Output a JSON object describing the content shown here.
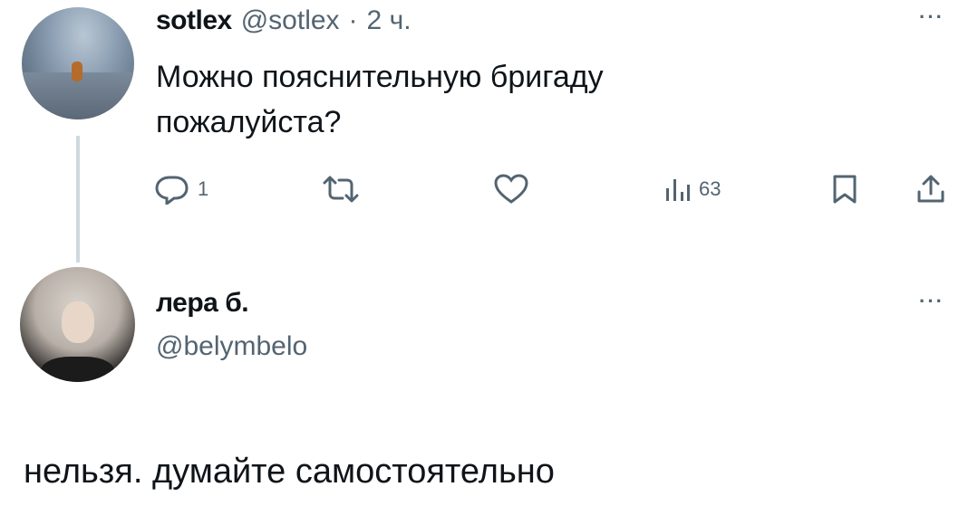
{
  "tweet1": {
    "author_name": "sotlex",
    "author_handle": "@sotlex",
    "separator": "·",
    "time": "2 ч.",
    "text_line1": "Можно пояснительную бригаду",
    "text_line2": "пожалуйста?",
    "more": "···",
    "actions": {
      "reply_count": "1",
      "retweet_count": "",
      "like_count": "",
      "views_count": "63"
    }
  },
  "tweet2": {
    "author_name": "лера б.",
    "author_handle": "@belymbelo",
    "more": "···",
    "text": "нельзя. думайте самостоятельно"
  },
  "colors": {
    "text": "#0f1419",
    "secondary": "#536471",
    "thread_line": "#cfd9de"
  }
}
